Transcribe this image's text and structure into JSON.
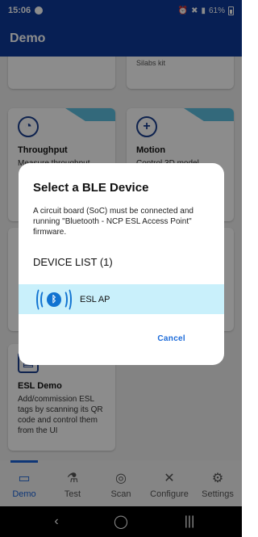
{
  "status_bar": {
    "time": "15:06",
    "battery": "61%"
  },
  "app_bar": {
    "title": "Demo"
  },
  "cards": {
    "top_right_sub": "Silabs kit",
    "throughput": {
      "title": "Throughput",
      "desc": "Measure throughput"
    },
    "motion": {
      "title": "Motion",
      "desc": "Control 3D model"
    },
    "esl": {
      "title": "ESL Demo",
      "desc": "Add/commission ESL tags by scanning its QR code and control them from the UI"
    }
  },
  "dialog": {
    "title": "Select a BLE Device",
    "message": "A circuit board (SoC) must be connected and running \"Bluetooth - NCP ESL Access Point\" firmware.",
    "list_header": "DEVICE LIST (1)",
    "devices": [
      {
        "name": "ESL AP",
        "icon": "bluetooth-icon"
      }
    ],
    "cancel_label": "Cancel"
  },
  "bottom_nav": [
    {
      "label": "Demo",
      "icon": "demo-icon",
      "active": true
    },
    {
      "label": "Test",
      "icon": "flask-icon",
      "active": false
    },
    {
      "label": "Scan",
      "icon": "scan-icon",
      "active": false
    },
    {
      "label": "Configure",
      "icon": "tools-icon",
      "active": false
    },
    {
      "label": "Settings",
      "icon": "gear-icon",
      "active": false
    }
  ],
  "colors": {
    "primary": "#0d3a99",
    "accent": "#1a63d9",
    "selected_row": "#c9f0fb",
    "flag": "#5dc0e0"
  }
}
